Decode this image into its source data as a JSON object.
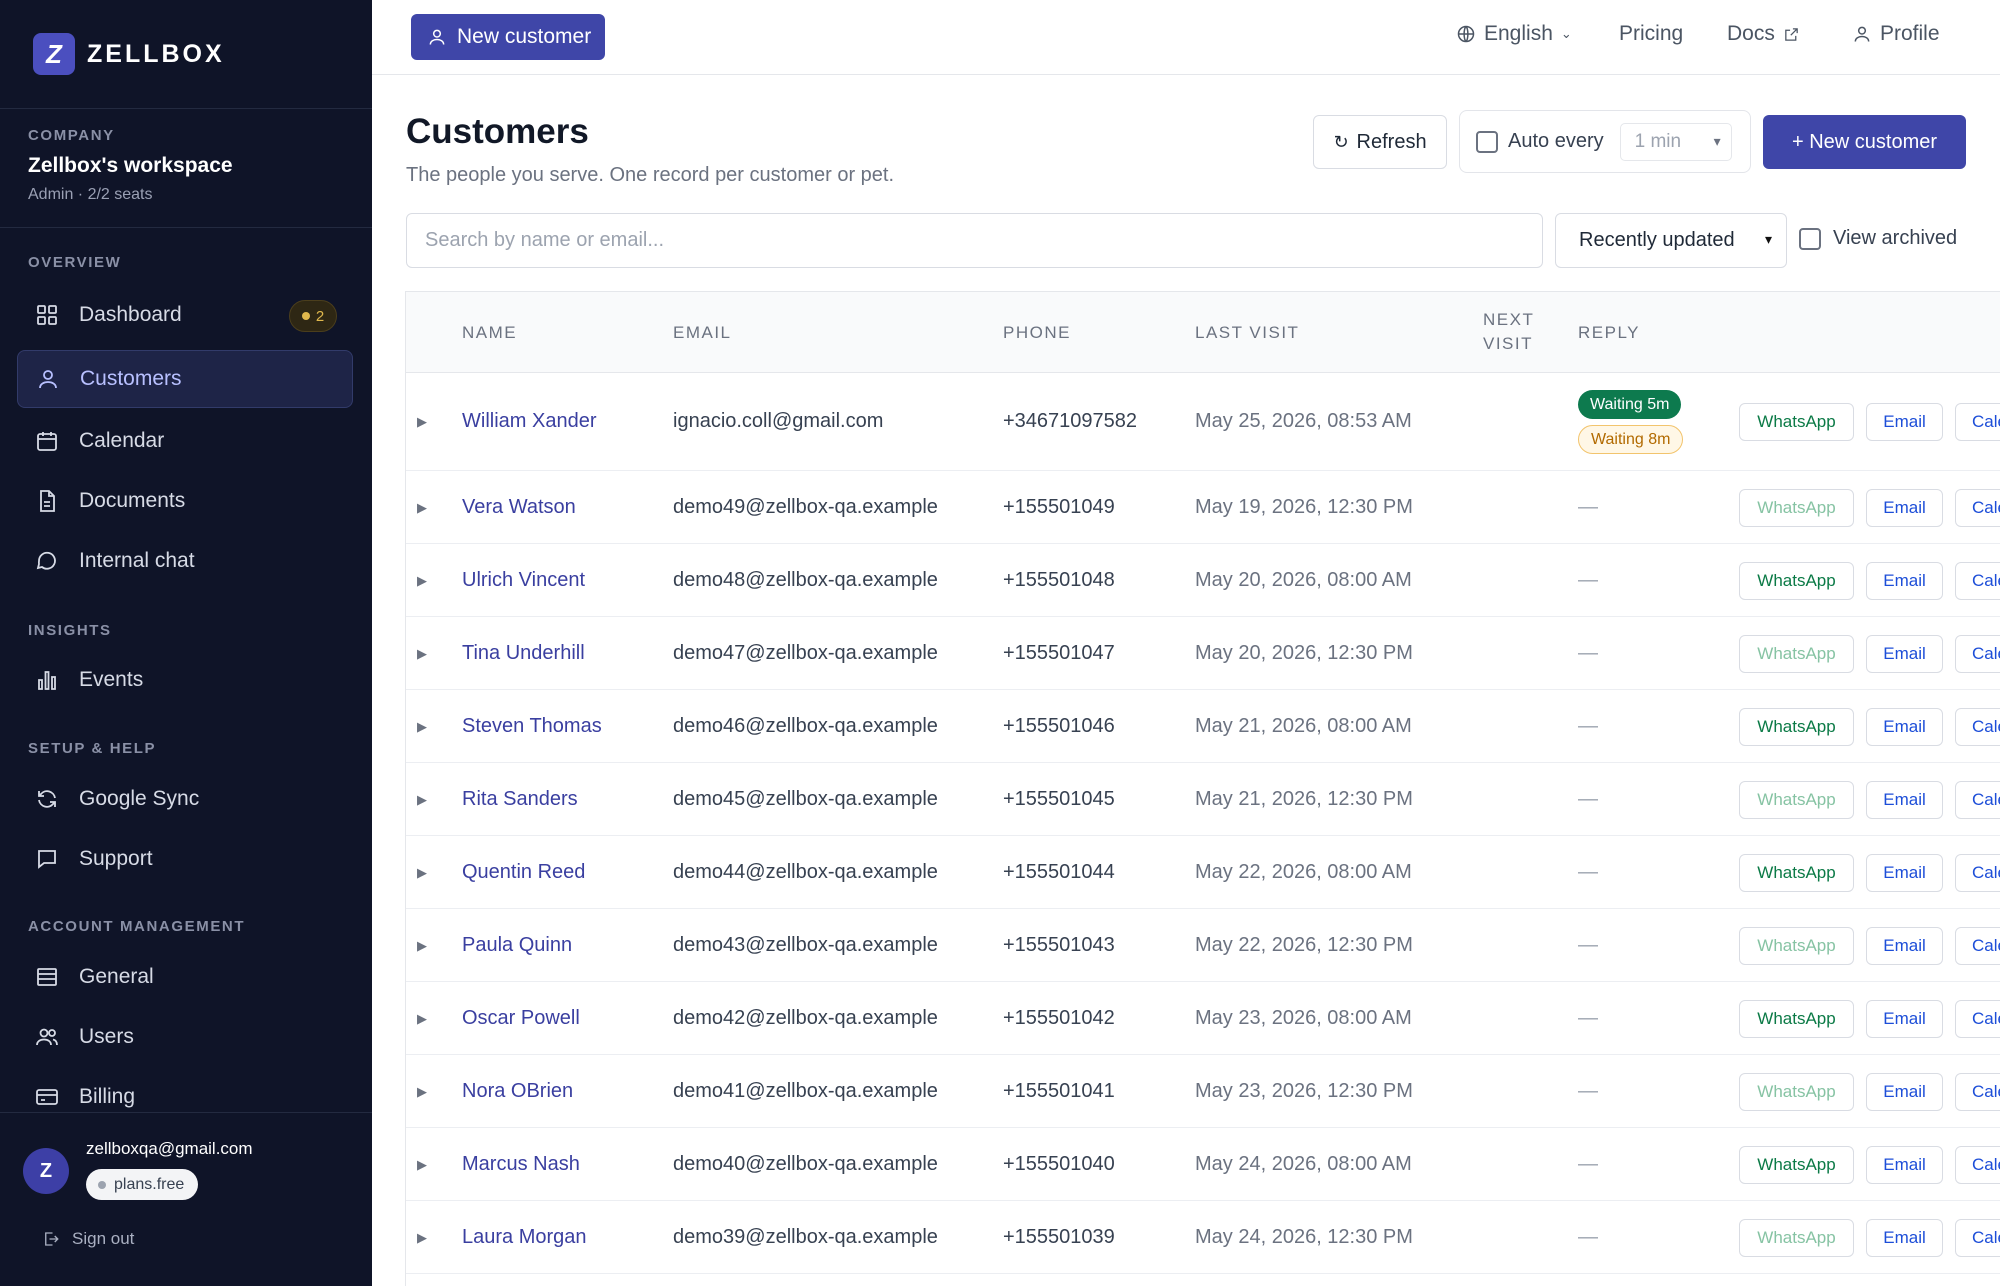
{
  "brand": {
    "name": "ZELLBOX",
    "mark": "Z",
    "accent": "#3f46a8"
  },
  "company": {
    "label": "COMPANY",
    "name": "Zellbox's workspace",
    "meta": "Admin · 2/2 seats"
  },
  "nav": {
    "overview_label": "OVERVIEW",
    "insights_label": "INSIGHTS",
    "setup_label": "SETUP & HELP",
    "account_label": "ACCOUNT MANAGEMENT",
    "dashboard": "Dashboard",
    "dashboard_badge": "2",
    "customers": "Customers",
    "calendar": "Calendar",
    "documents": "Documents",
    "internal_chat": "Internal chat",
    "events": "Events",
    "google_sync": "Google Sync",
    "support": "Support",
    "general": "General",
    "users": "Users",
    "billing": "Billing"
  },
  "user": {
    "avatar": "Z",
    "email": "zellboxqa@gmail.com",
    "plan": "plans.free",
    "signout": "Sign out"
  },
  "topbar": {
    "new_customer": "New customer",
    "language": "English",
    "pricing": "Pricing",
    "docs": "Docs",
    "profile": "Profile"
  },
  "page": {
    "title": "Customers",
    "subtitle": "The people you serve. One record per customer or pet.",
    "refresh": "Refresh",
    "auto_every": "Auto every",
    "auto_interval": "1 min",
    "new_customer": "+ New customer",
    "search_placeholder": "Search by name or email...",
    "sort": "Recently updated",
    "view_archived": "View archived"
  },
  "table": {
    "headers": {
      "name": "NAME",
      "email": "EMAIL",
      "phone": "PHONE",
      "last_visit": "LAST VISIT",
      "next_visit_1": "NEXT",
      "next_visit_2": "VISIT",
      "reply": "REPLY"
    },
    "actions": {
      "whatsapp": "WhatsApp",
      "email": "Email",
      "calendar": "Cale"
    },
    "rows": [
      {
        "name": "William Xander",
        "email": "ignacio.coll@gmail.com",
        "phone": "+34671097582",
        "last_visit": "May 25, 2026, 08:53 AM",
        "reply_green": "Waiting 5m",
        "reply_amber": "Waiting 8m",
        "whatsapp_active": true
      },
      {
        "name": "Vera Watson",
        "email": "demo49@zellbox-qa.example",
        "phone": "+155501049",
        "last_visit": "May 19, 2026, 12:30 PM",
        "reply": "—",
        "whatsapp_active": false
      },
      {
        "name": "Ulrich Vincent",
        "email": "demo48@zellbox-qa.example",
        "phone": "+155501048",
        "last_visit": "May 20, 2026, 08:00 AM",
        "reply": "—",
        "whatsapp_active": true
      },
      {
        "name": "Tina Underhill",
        "email": "demo47@zellbox-qa.example",
        "phone": "+155501047",
        "last_visit": "May 20, 2026, 12:30 PM",
        "reply": "—",
        "whatsapp_active": false
      },
      {
        "name": "Steven Thomas",
        "email": "demo46@zellbox-qa.example",
        "phone": "+155501046",
        "last_visit": "May 21, 2026, 08:00 AM",
        "reply": "—",
        "whatsapp_active": true
      },
      {
        "name": "Rita Sanders",
        "email": "demo45@zellbox-qa.example",
        "phone": "+155501045",
        "last_visit": "May 21, 2026, 12:30 PM",
        "reply": "—",
        "whatsapp_active": false
      },
      {
        "name": "Quentin Reed",
        "email": "demo44@zellbox-qa.example",
        "phone": "+155501044",
        "last_visit": "May 22, 2026, 08:00 AM",
        "reply": "—",
        "whatsapp_active": true
      },
      {
        "name": "Paula Quinn",
        "email": "demo43@zellbox-qa.example",
        "phone": "+155501043",
        "last_visit": "May 22, 2026, 12:30 PM",
        "reply": "—",
        "whatsapp_active": false
      },
      {
        "name": "Oscar Powell",
        "email": "demo42@zellbox-qa.example",
        "phone": "+155501042",
        "last_visit": "May 23, 2026, 08:00 AM",
        "reply": "—",
        "whatsapp_active": true
      },
      {
        "name": "Nora OBrien",
        "email": "demo41@zellbox-qa.example",
        "phone": "+155501041",
        "last_visit": "May 23, 2026, 12:30 PM",
        "reply": "—",
        "whatsapp_active": false
      },
      {
        "name": "Marcus Nash",
        "email": "demo40@zellbox-qa.example",
        "phone": "+155501040",
        "last_visit": "May 24, 2026, 08:00 AM",
        "reply": "—",
        "whatsapp_active": true
      },
      {
        "name": "Laura Morgan",
        "email": "demo39@zellbox-qa.example",
        "phone": "+155501039",
        "last_visit": "May 24, 2026, 12:30 PM",
        "reply": "—",
        "whatsapp_active": false
      }
    ]
  }
}
